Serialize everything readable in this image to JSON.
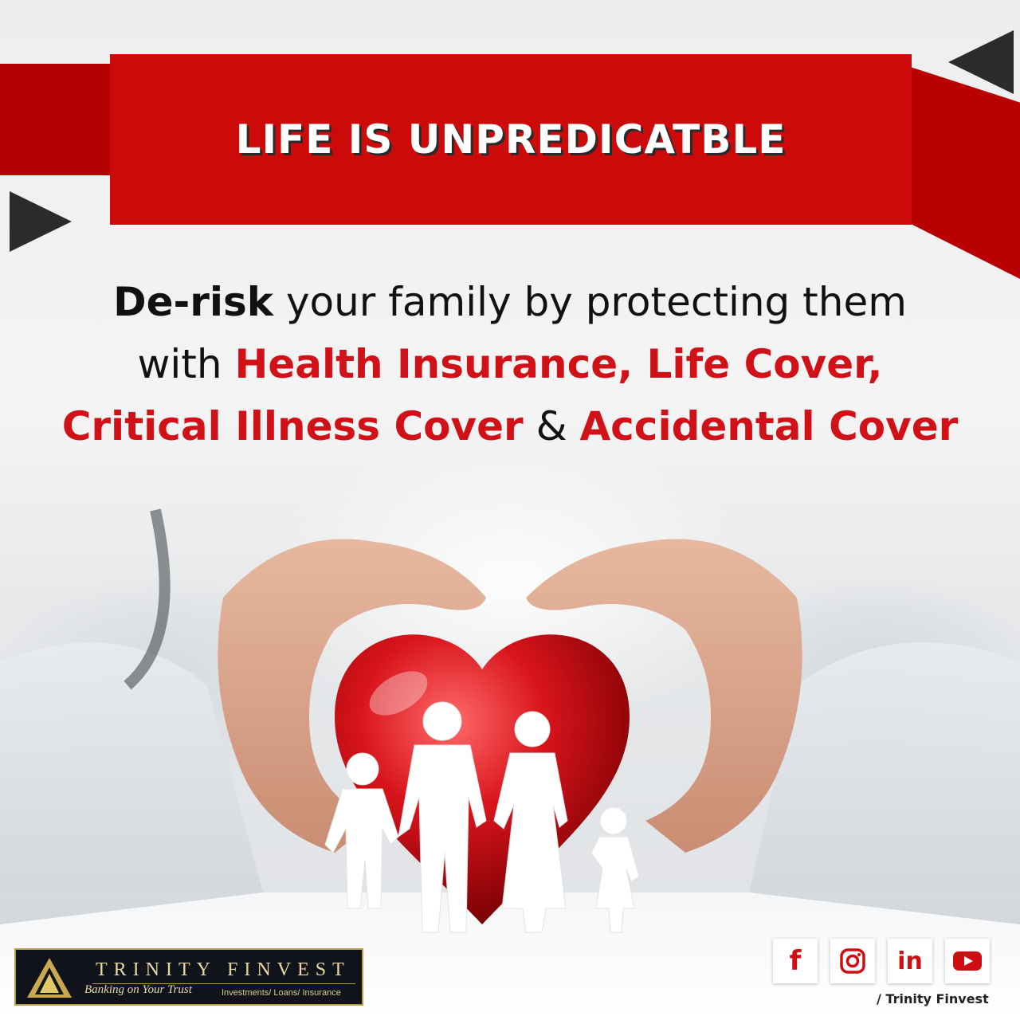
{
  "banner": {
    "title": "LIFE IS UNPREDICATBLE"
  },
  "headline": {
    "line1_bold": "De-risk",
    "line1_rest": " your family by protecting them",
    "line2_prefix": "with ",
    "line2_red": "Health Insurance, Life Cover,",
    "line3_red_a": "Critical Illness Cover",
    "line3_mid": " & ",
    "line3_red_b": "Accidental Cover"
  },
  "logo": {
    "name": "TRINITY FINVEST",
    "tagline": "Banking on Your Trust",
    "services": "Investments/ Loans/ Insurance"
  },
  "social": {
    "facebook": "f",
    "linkedin": "in",
    "handle": "/ Trinity Finvest",
    "icons": [
      "facebook-icon",
      "instagram-icon",
      "linkedin-icon",
      "youtube-icon"
    ]
  },
  "colors": {
    "brand_red": "#cc0a0a",
    "accent_red": "#d01118",
    "dark": "#2b2b2b",
    "gold": "#b89a4a"
  }
}
